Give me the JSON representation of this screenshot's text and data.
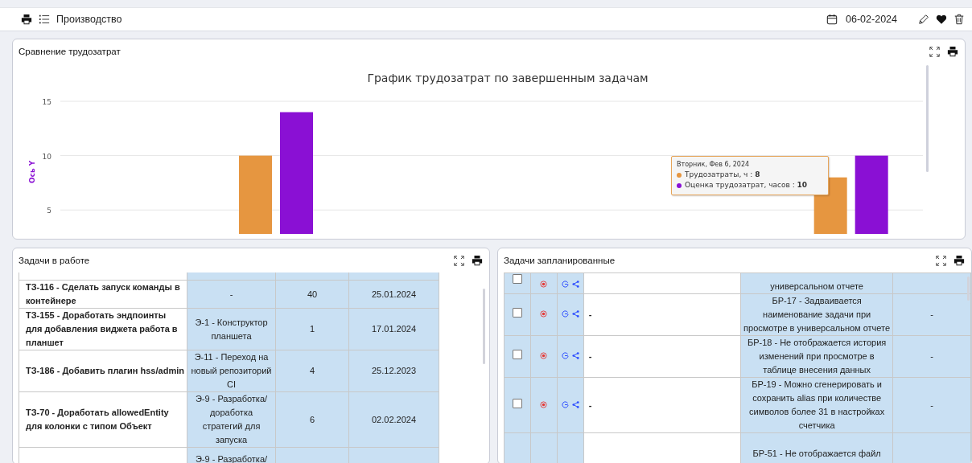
{
  "header": {
    "title": "Производство",
    "date": "06-02-2024"
  },
  "chart_panel": {
    "title": "Сравнение трудозатрат",
    "chart_data": {
      "type": "bar",
      "title": "График трудозатрат по завершенным задачам",
      "ylabel": "Ось Y",
      "grid": true,
      "ylim": [
        2.8,
        15
      ],
      "yticks": [
        5,
        10,
        15
      ],
      "series": [
        {
          "name": "Трудозатраты, ч",
          "color": "#e69640",
          "values": [
            null,
            10,
            null,
            null,
            null,
            8
          ]
        },
        {
          "name": "Оценка трудозатрат, часов",
          "color": "#8a10d4",
          "values": [
            null,
            14,
            null,
            null,
            null,
            10
          ]
        }
      ]
    },
    "tooltip": {
      "title": "Вторник, Фев 6, 2024",
      "separator": ":",
      "values": [
        "8",
        "10"
      ]
    }
  },
  "work_panel": {
    "title": "Задачи в работе",
    "rows": [
      {},
      {
        "task": "ТЗ-116 - Сделать запуск команды в контейнере",
        "epic": "-",
        "number": "40",
        "date": "25.01.2024"
      },
      {
        "task": "ТЗ-155 - Доработать эндпоинты для добавления виджета работа в планшет",
        "epic": "Э-1 - Конструктор планшета",
        "number": "1",
        "date": "17.01.2024"
      },
      {
        "task": "ТЗ-186 - Добавить плагин hss/admin",
        "epic": "Э-11 - Переход на новый репозиторий CI",
        "number": "4",
        "date": "25.12.2023"
      },
      {
        "task": "ТЗ-70 - Доработать allowedEntity для колонки с типом Объект",
        "epic": "Э-9 - Разработка/ доработка стратегий для запуска",
        "number": "6",
        "date": "02.02.2024"
      },
      {
        "epic": "Э-9 - Разработка/"
      }
    ]
  },
  "planned_panel": {
    "title": "Задачи запланированные",
    "rows": [
      {
        "checked": false,
        "description": "универсальном отчете"
      },
      {
        "checked": false,
        "column_4": "-",
        "description": "БР-17 - Задваивается наименование задачи при просмотре в универсальном отчете",
        "column_6": "-"
      },
      {
        "checked": false,
        "column_4": "-",
        "description": "БР-18 - Не отображается история изменений при просмотре в таблице внесения данных",
        "column_6": "-"
      },
      {
        "checked": false,
        "column_4": "-",
        "description": "БР-19 - Можно сгенерировать и сохранить alias при количестве символов более 31 в настройках счетчика",
        "column_6": "-"
      },
      {
        "description": "БР-51 - Не отображается файл"
      }
    ]
  }
}
